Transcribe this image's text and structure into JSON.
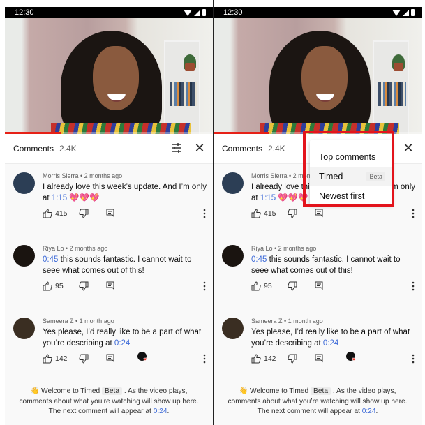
{
  "status_bar": {
    "time": "12:30"
  },
  "video": {
    "progress_fraction": 0.27
  },
  "comments_header": {
    "title": "Comments",
    "count": "2.4K"
  },
  "comments": [
    {
      "author": "Morris Sierra",
      "age": "2 months ago",
      "meta": "Morris Sierra • 2 months ago",
      "text_before": "I already love this week’s update. And I’m only at ",
      "timestamp": "1:15",
      "text_after": " 💖💖💖",
      "likes": "415",
      "avatar_color": "#2c3e55",
      "creator_heart": false
    },
    {
      "author": "Riya Lo",
      "age": "2 months ago",
      "meta": "Riya Lo • 2 months ago",
      "text_before": "",
      "timestamp": "0:45",
      "text_after": " this sounds fantastic. I cannot wait to seee what comes out of this!",
      "likes": "95",
      "avatar_color": "#1a1410",
      "creator_heart": false
    },
    {
      "author": "Sameera Z",
      "age": "1 month ago",
      "meta": "Sameera Z • 1 month ago",
      "text_before": "Yes please, I’d really like to be a part of what you’re describing at ",
      "timestamp": "0:24",
      "text_after": "",
      "likes": "142",
      "avatar_color": "#3a2e22",
      "creator_heart": true
    }
  ],
  "timed_banner": {
    "emoji": "👋",
    "line1_before": " Welcome to Timed ",
    "beta": "Beta",
    "line1_after": " . As the video plays,",
    "line2": "comments about what you’re watching will show up here.",
    "line3_before": "The next comment will appear at ",
    "line3_timestamp": "0:24",
    "line3_after": "."
  },
  "sort_menu": {
    "items": [
      {
        "label": "Top comments",
        "badge": ""
      },
      {
        "label": "Timed",
        "badge": "Beta"
      },
      {
        "label": "Newest first",
        "badge": ""
      }
    ],
    "highlighted": "Timed"
  },
  "colors": {
    "accent_red": "#e62117",
    "timestamp_blue": "#3e6bd8",
    "highlight_box": "#e3141c"
  }
}
